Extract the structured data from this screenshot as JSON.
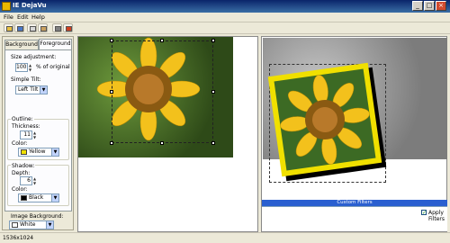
{
  "window": {
    "title": "IE DejaVu"
  },
  "menu": {
    "items": [
      "File",
      "Edit",
      "Help"
    ]
  },
  "tabs": {
    "background": "Background",
    "foreground": "Foreground"
  },
  "size": {
    "label": "Size adjustment:",
    "value": "100",
    "suffix": "% of original"
  },
  "simple_tilt": {
    "label": "Simple Tilt:",
    "value": "Left Tilt"
  },
  "outline": {
    "label": "Outline:",
    "thickness_label": "Thickness:",
    "thickness_value": "11",
    "color_label": "Color:",
    "color_value": "Yellow",
    "color_hex": "#f0e000"
  },
  "shadow": {
    "label": "Shadow:",
    "depth_label": "Depth:",
    "depth_value": "6",
    "color_label": "Color:",
    "color_value": "Black",
    "color_hex": "#000000"
  },
  "image_background": {
    "label": "Image Background:",
    "value": "White",
    "color_hex": "#ffffff"
  },
  "custom_filters": {
    "title": "Custom Filters",
    "apply_label": "Apply Filters",
    "apply_checked": true
  },
  "status": {
    "resolution": "1536x1024"
  }
}
